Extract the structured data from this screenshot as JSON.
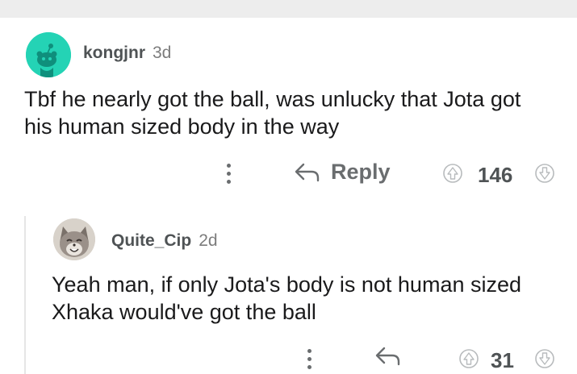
{
  "comments": [
    {
      "author": "kongjnr",
      "age": "3d",
      "text": "Tbf he nearly got the ball, was unlucky that Jota got his human sized body in the way",
      "reply_label": "Reply",
      "score": "146",
      "avatar": "snoo-avatar"
    },
    {
      "author": "Quite_Cip",
      "age": "2d",
      "text": "Yeah man, if only Jota's body is not human sized Xhaka would've got the ball",
      "reply_label": "",
      "score": "31",
      "avatar": "cat-photo-avatar"
    }
  ],
  "colors": {
    "snoo_avatar_bg": "#24d3b5",
    "text": "#1a1a1b",
    "meta": "#7c7c7c",
    "icon": "#6a6d6f"
  }
}
